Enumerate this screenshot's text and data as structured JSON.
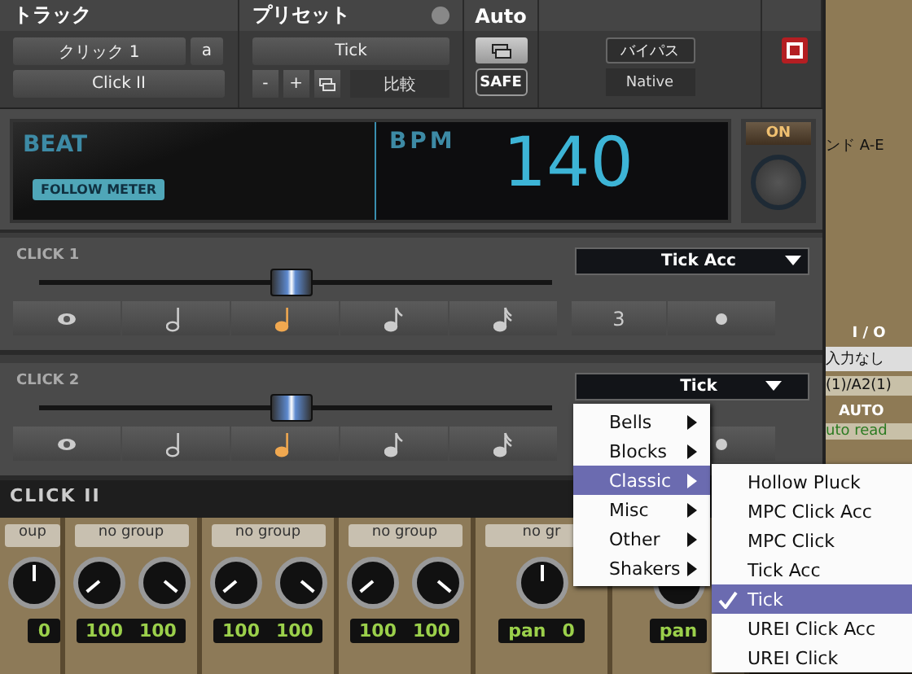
{
  "header": {
    "track_label": "トラック",
    "preset_label": "プリセット",
    "auto_label": "Auto"
  },
  "track": {
    "name": "クリック 1",
    "channel": "a",
    "plugin": "Click II"
  },
  "preset": {
    "name": "Tick",
    "minus": "-",
    "plus": "+",
    "compare": "比較"
  },
  "auto": {
    "safe": "SAFE"
  },
  "bypass": "バイパス",
  "native": "Native",
  "display": {
    "beat": "BEAT",
    "follow_meter": "FOLLOW METER",
    "bpm_label": "BPM",
    "bpm": "140",
    "on": "ON"
  },
  "clicks": [
    {
      "label": "CLICK 1",
      "level": 0.49,
      "sound": "Tick Acc",
      "notes": [
        {
          "kind": "whole",
          "selected": false
        },
        {
          "kind": "half",
          "selected": false
        },
        {
          "kind": "quarter",
          "selected": true
        },
        {
          "kind": "eighth",
          "selected": false
        },
        {
          "kind": "sixteenth",
          "selected": false
        },
        {
          "kind": "triplet",
          "label": "3",
          "selected": false
        },
        {
          "kind": "dot",
          "selected": false
        }
      ]
    },
    {
      "label": "CLICK 2",
      "level": 0.49,
      "sound": "Tick",
      "notes": [
        {
          "kind": "whole",
          "selected": false
        },
        {
          "kind": "half",
          "selected": false
        },
        {
          "kind": "quarter",
          "selected": true
        },
        {
          "kind": "eighth",
          "selected": false
        },
        {
          "kind": "sixteenth",
          "selected": false
        },
        {
          "kind": "dot",
          "selected": false
        }
      ]
    }
  ],
  "footer": "CLICK II",
  "side": {
    "send": "ンド A-E",
    "io": "I / O",
    "input": "入力なし",
    "output": "(1)/A2(1)",
    "auto": "AUTO",
    "auto_mode": "uto read"
  },
  "strips": [
    {
      "kind": "mono",
      "group": "oup",
      "display": [
        "0"
      ]
    },
    {
      "kind": "stereo",
      "group": "no group",
      "display": [
        "100",
        "100"
      ]
    },
    {
      "kind": "stereo",
      "group": "no group",
      "display": [
        "100",
        "100"
      ]
    },
    {
      "kind": "stereo",
      "group": "no group",
      "display": [
        "100",
        "100"
      ]
    },
    {
      "kind": "mono",
      "group": "no gr",
      "display": [
        "pan",
        "0"
      ]
    },
    {
      "kind": "mono",
      "display": [
        "pan"
      ]
    }
  ],
  "menu": {
    "items": [
      {
        "label": "Bells",
        "selected": false
      },
      {
        "label": "Blocks",
        "selected": false
      },
      {
        "label": "Classic",
        "selected": true
      },
      {
        "label": "Misc",
        "selected": false
      },
      {
        "label": "Other",
        "selected": false
      },
      {
        "label": "Shakers",
        "selected": false
      }
    ],
    "submenu": [
      {
        "label": "Hollow Pluck",
        "checked": false
      },
      {
        "label": "MPC Click Acc",
        "checked": false
      },
      {
        "label": "MPC Click",
        "checked": false
      },
      {
        "label": "Tick Acc",
        "checked": false
      },
      {
        "label": "Tick",
        "checked": true
      },
      {
        "label": "UREI Click Acc",
        "checked": false
      },
      {
        "label": "UREI Click",
        "checked": false
      }
    ]
  }
}
